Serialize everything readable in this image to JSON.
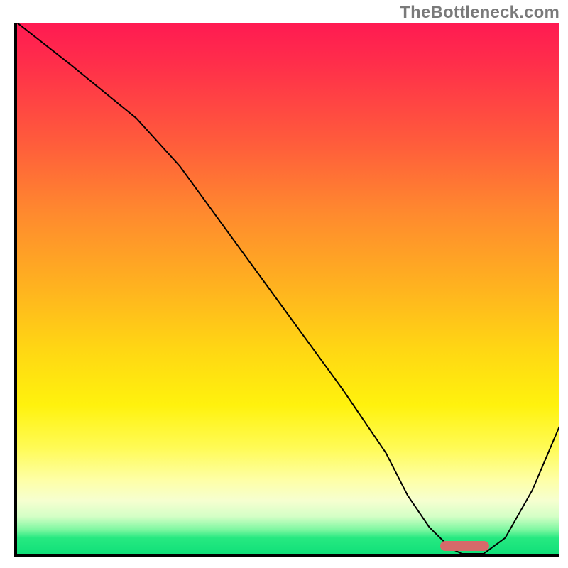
{
  "watermark": "TheBottleneck.com",
  "colors": {
    "border": "#000000",
    "curve": "#000000",
    "marker": "#d66a6a"
  },
  "chart_data": {
    "type": "line",
    "title": "",
    "xlabel": "",
    "ylabel": "",
    "xlim": [
      0,
      100
    ],
    "ylim": [
      0,
      100
    ],
    "background": "bottleneck-gradient (red→yellow→green vertical)",
    "series": [
      {
        "name": "bottleneck-curve",
        "x": [
          0,
          10,
          22,
          30,
          40,
          50,
          60,
          68,
          72,
          76,
          80,
          82,
          86,
          90,
          95,
          100
        ],
        "values": [
          100,
          92,
          82,
          73,
          59,
          45,
          31,
          19,
          11,
          5,
          1,
          0,
          0,
          3,
          12,
          24
        ]
      }
    ],
    "marker": {
      "x_start": 78,
      "x_end": 87,
      "y": 0.5
    },
    "grid": false,
    "legend": false
  }
}
